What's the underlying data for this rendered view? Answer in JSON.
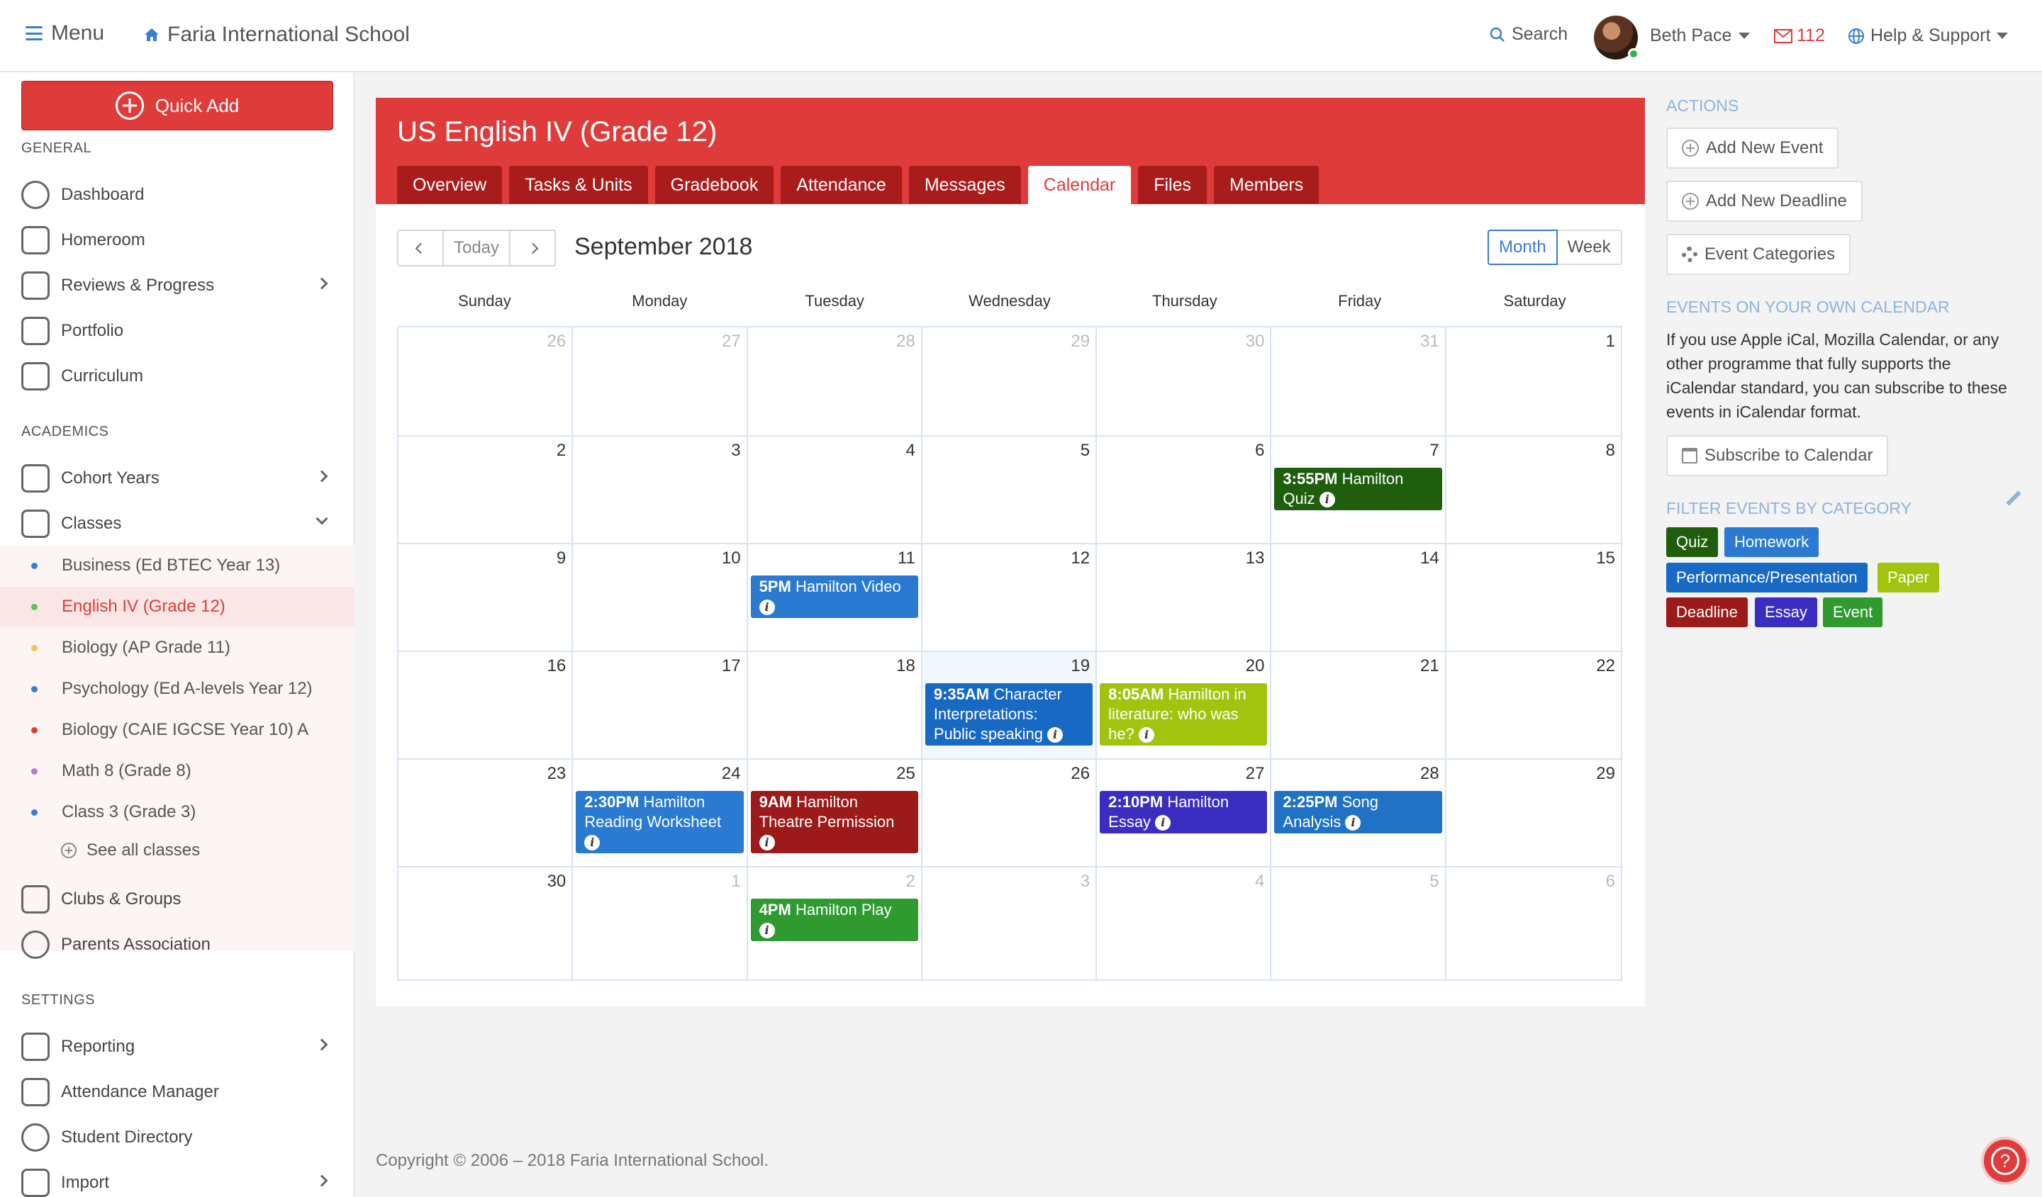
{
  "topbar": {
    "menu_label": "Menu",
    "school_name": "Faria International School",
    "search_label": "Search",
    "user_name": "Beth Pace",
    "mail_count": "112",
    "help_label": "Help & Support"
  },
  "sidebar": {
    "quick_add": "Quick Add",
    "section_general": "GENERAL",
    "general_items": [
      "Dashboard",
      "Homeroom",
      "Reviews & Progress",
      "Portfolio",
      "Curriculum"
    ],
    "section_academics": "ACADEMICS",
    "cohort_years": "Cohort Years",
    "classes": "Classes",
    "class_items": [
      {
        "label": "Business (Ed BTEC Year 13)",
        "color": "#3a7bd5"
      },
      {
        "label": "English IV (Grade 12)",
        "color": "#5cc05c"
      },
      {
        "label": "Biology (AP Grade 11)",
        "color": "#f5c84a"
      },
      {
        "label": "Psychology (Ed A-levels Year 12)",
        "color": "#3a7bd5"
      },
      {
        "label": "Biology (CAIE IGCSE Year 10) A",
        "color": "#e03b3b"
      },
      {
        "label": "Math 8 (Grade 8)",
        "color": "#b57ad6"
      },
      {
        "label": "Class 3 (Grade 3)",
        "color": "#3a7bd5"
      }
    ],
    "see_all": "See all classes",
    "clubs": "Clubs & Groups",
    "parents": "Parents Association",
    "section_settings": "SETTINGS",
    "settings_items": [
      "Reporting",
      "Attendance Manager",
      "Student Directory",
      "Import"
    ]
  },
  "course": {
    "title": "US English IV (Grade 12)",
    "tabs": [
      "Overview",
      "Tasks & Units",
      "Gradebook",
      "Attendance",
      "Messages",
      "Calendar",
      "Files",
      "Members"
    ],
    "active_tab": "Calendar"
  },
  "calendar": {
    "today_label": "Today",
    "month_title": "September 2018",
    "view_month": "Month",
    "view_week": "Week",
    "days_of_week": [
      "Sunday",
      "Monday",
      "Tuesday",
      "Wednesday",
      "Thursday",
      "Friday",
      "Saturday"
    ],
    "weeks": [
      [
        "26",
        "27",
        "28",
        "29",
        "30",
        "31",
        "1"
      ],
      [
        "2",
        "3",
        "4",
        "5",
        "6",
        "7",
        "8"
      ],
      [
        "9",
        "10",
        "11",
        "12",
        "13",
        "14",
        "15"
      ],
      [
        "16",
        "17",
        "18",
        "19",
        "20",
        "21",
        "22"
      ],
      [
        "23",
        "24",
        "25",
        "26",
        "27",
        "28",
        "29"
      ],
      [
        "30",
        "1",
        "2",
        "3",
        "4",
        "5",
        "6"
      ]
    ],
    "events": [
      {
        "week": 1,
        "day": 5,
        "time": "3:55PM",
        "title": "Hamilton Quiz",
        "color": "#1f5e0d"
      },
      {
        "week": 2,
        "day": 2,
        "time": "5PM",
        "title": "Hamilton Video",
        "color": "#2a7ad2"
      },
      {
        "week": 3,
        "day": 3,
        "time": "9:35AM",
        "title": "Character Interpretations: Public speaking",
        "color": "#1769c4"
      },
      {
        "week": 3,
        "day": 4,
        "time": "8:05AM",
        "title": "Hamilton in literature: who was he?",
        "color": "#a3c40e"
      },
      {
        "week": 4,
        "day": 1,
        "time": "2:30PM",
        "title": "Hamilton Reading Worksheet",
        "color": "#2a7ad2"
      },
      {
        "week": 4,
        "day": 2,
        "time": "9AM",
        "title": "Hamilton Theatre Permission",
        "color": "#9c1a1a"
      },
      {
        "week": 4,
        "day": 4,
        "time": "2:10PM",
        "title": "Hamilton Essay",
        "color": "#3a2ec2"
      },
      {
        "week": 4,
        "day": 5,
        "time": "2:25PM",
        "title": "Song Analysis",
        "color": "#1f72c4"
      },
      {
        "week": 5,
        "day": 2,
        "time": "4PM",
        "title": "Hamilton Play",
        "color": "#2f9a2f"
      }
    ]
  },
  "right_panel": {
    "actions_label": "ACTIONS",
    "add_event": "Add New Event",
    "add_deadline": "Add New Deadline",
    "event_categories": "Event Categories",
    "own_calendar_label": "EVENTS ON YOUR OWN CALENDAR",
    "own_calendar_text": "If you use Apple iCal, Mozilla Calendar, or any other programme that fully supports the iCalendar standard, you can subscribe to these events in iCalendar format.",
    "subscribe": "Subscribe to Calendar",
    "filter_label": "FILTER EVENTS BY CATEGORY",
    "categories": [
      {
        "label": "Quiz",
        "color": "#1f5e0d"
      },
      {
        "label": "Homework",
        "color": "#2a7ad2"
      },
      {
        "label": "Performance/Presentation",
        "color": "#1769c4"
      },
      {
        "label": "Paper",
        "color": "#a3c40e"
      },
      {
        "label": "Deadline",
        "color": "#9c1a1a"
      },
      {
        "label": "Essay",
        "color": "#3a2ec2"
      },
      {
        "label": "Event",
        "color": "#2f9a2f"
      }
    ]
  },
  "footer": {
    "copyright": "Copyright © 2006 – 2018 Faria International School."
  }
}
